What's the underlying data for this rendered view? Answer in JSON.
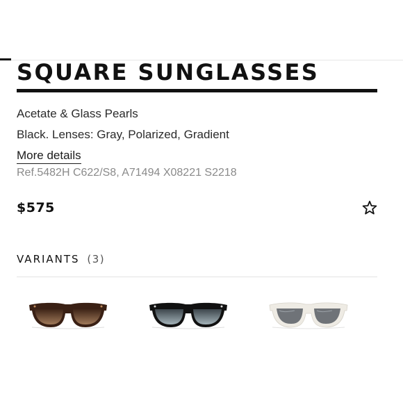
{
  "product": {
    "title": "SQUARE SUNGLASSES",
    "material": "Acetate & Glass Pearls",
    "color_lenses": "Black. Lenses: Gray, Polarized, Gradient",
    "more_details_label": "More details",
    "reference": "Ref.5482H C622/S8, A71494 X08221 S2218",
    "price": "$575"
  },
  "variants": {
    "label": "VARIANTS",
    "count": "(3)",
    "items": [
      {
        "name": "tortoise-brown-gradient",
        "frame_color": "#3a2014",
        "lens_color": "#6b4a34"
      },
      {
        "name": "black-gray-gradient",
        "frame_color": "#111111",
        "lens_color": "#5d6b72"
      },
      {
        "name": "ivory-gray",
        "frame_color": "#ece9e2",
        "lens_color": "#6f7378"
      }
    ]
  }
}
